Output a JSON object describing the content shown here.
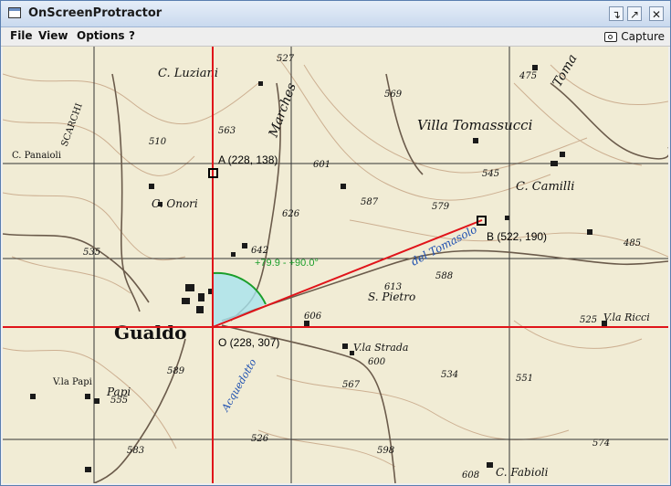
{
  "window": {
    "title": "OnScreenProtractor"
  },
  "menu": {
    "items": [
      "File",
      "View",
      "Options",
      "?"
    ],
    "capture_label": "Capture"
  },
  "window_controls": [
    "minimize-icon",
    "maximize-icon",
    "close-icon"
  ],
  "map": {
    "place_names": [
      "C. Luziani",
      "Villa Tomassucci",
      "C. Panaioli",
      "C. Onori",
      "C. Camilli",
      "S. Pietro",
      "Gualdo",
      "V.la Strada",
      "V.la Ricci",
      "V.la Papi",
      "Papi",
      "C. Fabioli",
      "del Tomasolo",
      "Marches",
      "Acquedotto",
      "Toma",
      "SCARCHI"
    ],
    "elevations": [
      "527",
      "569",
      "475",
      "563",
      "510",
      "601",
      "545",
      "587",
      "579",
      "626",
      "535",
      "642",
      "588",
      "613",
      "606",
      "485",
      "525",
      "589",
      "555",
      "600",
      "534",
      "551",
      "567",
      "526",
      "583",
      "598",
      "574",
      "608"
    ]
  },
  "protractor": {
    "point_a": "A (228, 138)",
    "point_b": "B (522, 190)",
    "point_o": "O (228, 307)",
    "angle_label": "+79.9 - +90.0°",
    "colors": {
      "lines": "#e0141a",
      "arc": "#1a9e2a",
      "fill": "#a8e4ee"
    }
  }
}
